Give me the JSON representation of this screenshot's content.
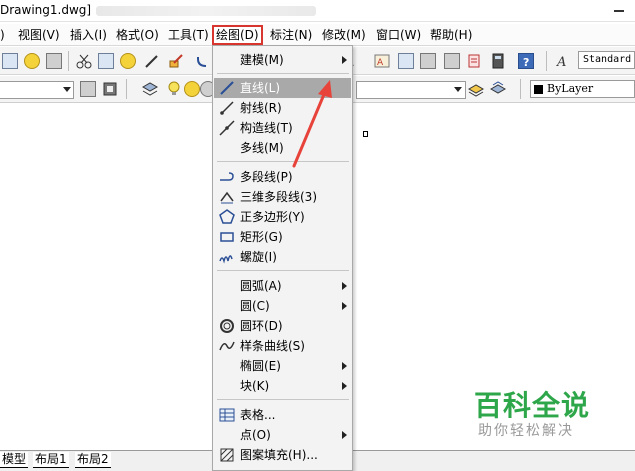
{
  "window": {
    "title": "Drawing1.dwg]"
  },
  "menubar": {
    "items": [
      "视图(V)",
      "插入(I)",
      "格式(O)",
      "工具(T)",
      "绘图(D)",
      "标注(N)",
      "修改(M)",
      "窗口(W)",
      "帮助(H)"
    ],
    "leading_fragment": ")"
  },
  "toolbar": {
    "text_style": "Standard",
    "color_value": "ByLayer"
  },
  "draw_menu": {
    "items": [
      {
        "label": "建模(M)",
        "icon": "",
        "submenu": true
      },
      {
        "label": "直线(L)",
        "icon": "line-icon",
        "submenu": false,
        "highlighted": true
      },
      {
        "label": "射线(R)",
        "icon": "ray-icon",
        "submenu": false
      },
      {
        "label": "构造线(T)",
        "icon": "construction-line-icon",
        "submenu": false
      },
      {
        "label": "多线(M)",
        "icon": "",
        "submenu": false
      },
      {
        "label": "多段线(P)",
        "icon": "polyline-icon",
        "submenu": false
      },
      {
        "label": "三维多段线(3)",
        "icon": "3d-polyline-icon",
        "submenu": false
      },
      {
        "label": "正多边形(Y)",
        "icon": "polygon-icon",
        "submenu": false
      },
      {
        "label": "矩形(G)",
        "icon": "rectangle-icon",
        "submenu": false
      },
      {
        "label": "螺旋(I)",
        "icon": "helix-icon",
        "submenu": false
      },
      {
        "label": "圆弧(A)",
        "icon": "",
        "submenu": true
      },
      {
        "label": "圆(C)",
        "icon": "",
        "submenu": true
      },
      {
        "label": "圆环(D)",
        "icon": "donut-icon",
        "submenu": false
      },
      {
        "label": "样条曲线(S)",
        "icon": "spline-icon",
        "submenu": false
      },
      {
        "label": "椭圆(E)",
        "icon": "",
        "submenu": true
      },
      {
        "label": "块(K)",
        "icon": "",
        "submenu": true
      },
      {
        "label": "表格...",
        "icon": "table-icon",
        "submenu": false
      },
      {
        "label": "点(O)",
        "icon": "",
        "submenu": true
      },
      {
        "label": "图案填充(H)...",
        "icon": "hatch-icon",
        "submenu": false
      }
    ]
  },
  "layout_tabs": [
    "模型",
    "布局1",
    "布局2"
  ],
  "watermark": {
    "title": "百科全说",
    "subtitle": "助你轻松解决"
  },
  "colors": {
    "highlight": "#a9a9a9",
    "annotation_red": "#e8433a",
    "watermark_green": "#2ea64a"
  }
}
